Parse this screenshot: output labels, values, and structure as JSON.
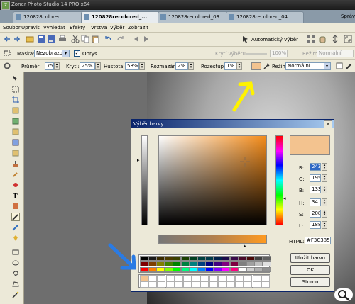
{
  "app": {
    "title": "Zoner Photo Studio 14 PRO x64",
    "icon_label": "Z"
  },
  "tabs": [
    {
      "label": "120828colored",
      "active": false
    },
    {
      "label": "120828recolored_...",
      "active": true
    },
    {
      "label": "120828recolored_03....",
      "active": false
    },
    {
      "label": "120828recolored_04....",
      "active": false
    }
  ],
  "tab_close_glyph": "×",
  "tab_right_label": "Správ",
  "menu": [
    "Soubor",
    "Upravit",
    "Vyhledat",
    "Efekty",
    "Vrstva",
    "Výběr",
    "Zobrazit"
  ],
  "toolbar": {
    "auto_select": "Automatický výběr"
  },
  "options1": {
    "mask_label": "Maska:",
    "mask_value": "Nezobrazovat",
    "frames_label": "Obrys",
    "transparency_label": "Krytí výběru",
    "transparency_value": "100%",
    "mode_label": "Režim:",
    "mode_value": "Normální"
  },
  "options2": {
    "diameter_label": "Průměr:",
    "diameter_value": "75",
    "opacity_label": "Krytí:",
    "opacity_value": "25%",
    "density_label": "Hustota:",
    "density_value": "58%",
    "blur_label": "Rozmazání:",
    "blur_value": "2%",
    "spacing_label": "Rozestup:",
    "spacing_value": "1%",
    "mode_label": "Režim:",
    "mode_value": "Normální",
    "current_color": "#F3C38F"
  },
  "dialog": {
    "title": "Výběr barvy",
    "close_glyph": "×",
    "selected_color": "#F3C38F",
    "fields": [
      {
        "label": "R:",
        "value": "243"
      },
      {
        "label": "G:",
        "value": "195"
      },
      {
        "label": "B:",
        "value": "133"
      },
      {
        "label": "H:",
        "value": "34"
      },
      {
        "label": "S:",
        "value": "208"
      },
      {
        "label": "L:",
        "value": "188"
      }
    ],
    "html_label": "HTML:",
    "html_value": "#F3C385",
    "save_label": "Uložit barvu",
    "ok_label": "OK",
    "cancel_label": "Storno",
    "palette_row1": [
      "#000000",
      "#1a1a1a",
      "#3a2a00",
      "#4a3a00",
      "#3a4000",
      "#1a4000",
      "#004020",
      "#004040",
      "#003a4a",
      "#00204a",
      "#1a0a4a",
      "#3a0a4a",
      "#4a0a2a",
      "#4a0a0a",
      "#404040",
      "#606060"
    ],
    "palette_row2": [
      "#800000",
      "#804000",
      "#808000",
      "#408000",
      "#008000",
      "#008040",
      "#008080",
      "#004080",
      "#000080",
      "#400080",
      "#800080",
      "#800040",
      "#808080",
      "#a0a0a0",
      "#c0c0c0",
      "#e0e0e0"
    ],
    "palette_row3": [
      "#ff0000",
      "#ff8000",
      "#ffff00",
      "#80ff00",
      "#00ff00",
      "#00ff80",
      "#00ffff",
      "#0080ff",
      "#0000ff",
      "#8000ff",
      "#ff00ff",
      "#ff0080",
      "#ffffff",
      "#d0d0d0",
      "#b0b0b0",
      "#909090"
    ],
    "custom_first": "#F3C38F"
  },
  "colors": {
    "arrow_yellow": "#FFF200",
    "arrow_blue": "#2A7BE4",
    "accent": "#0A246A"
  }
}
